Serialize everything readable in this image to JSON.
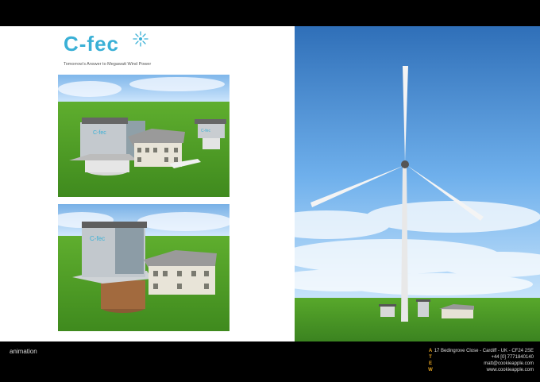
{
  "brand": {
    "logo_text": "C-fec",
    "tagline": "Tomorrow's Answer to Megawatt Wind Power"
  },
  "renders": {
    "top_label": "C-fec",
    "bottom_label": "C-fec"
  },
  "footer": {
    "label": "animation",
    "atew_letters": [
      "A",
      "T",
      "E",
      "W"
    ],
    "contact": {
      "address": "17 Bedingrove Close - Cardiff - UK - CF24 2SE",
      "phone": "+44 [0] 7771840140",
      "email": "matt@cookieapple.com",
      "website": "www.cookieapple.com"
    }
  },
  "colors": {
    "accent": "#3ab0d6",
    "footer_accent": "#e0a020",
    "grass": "#4f9a2a",
    "sky": "#5b9fe0"
  }
}
